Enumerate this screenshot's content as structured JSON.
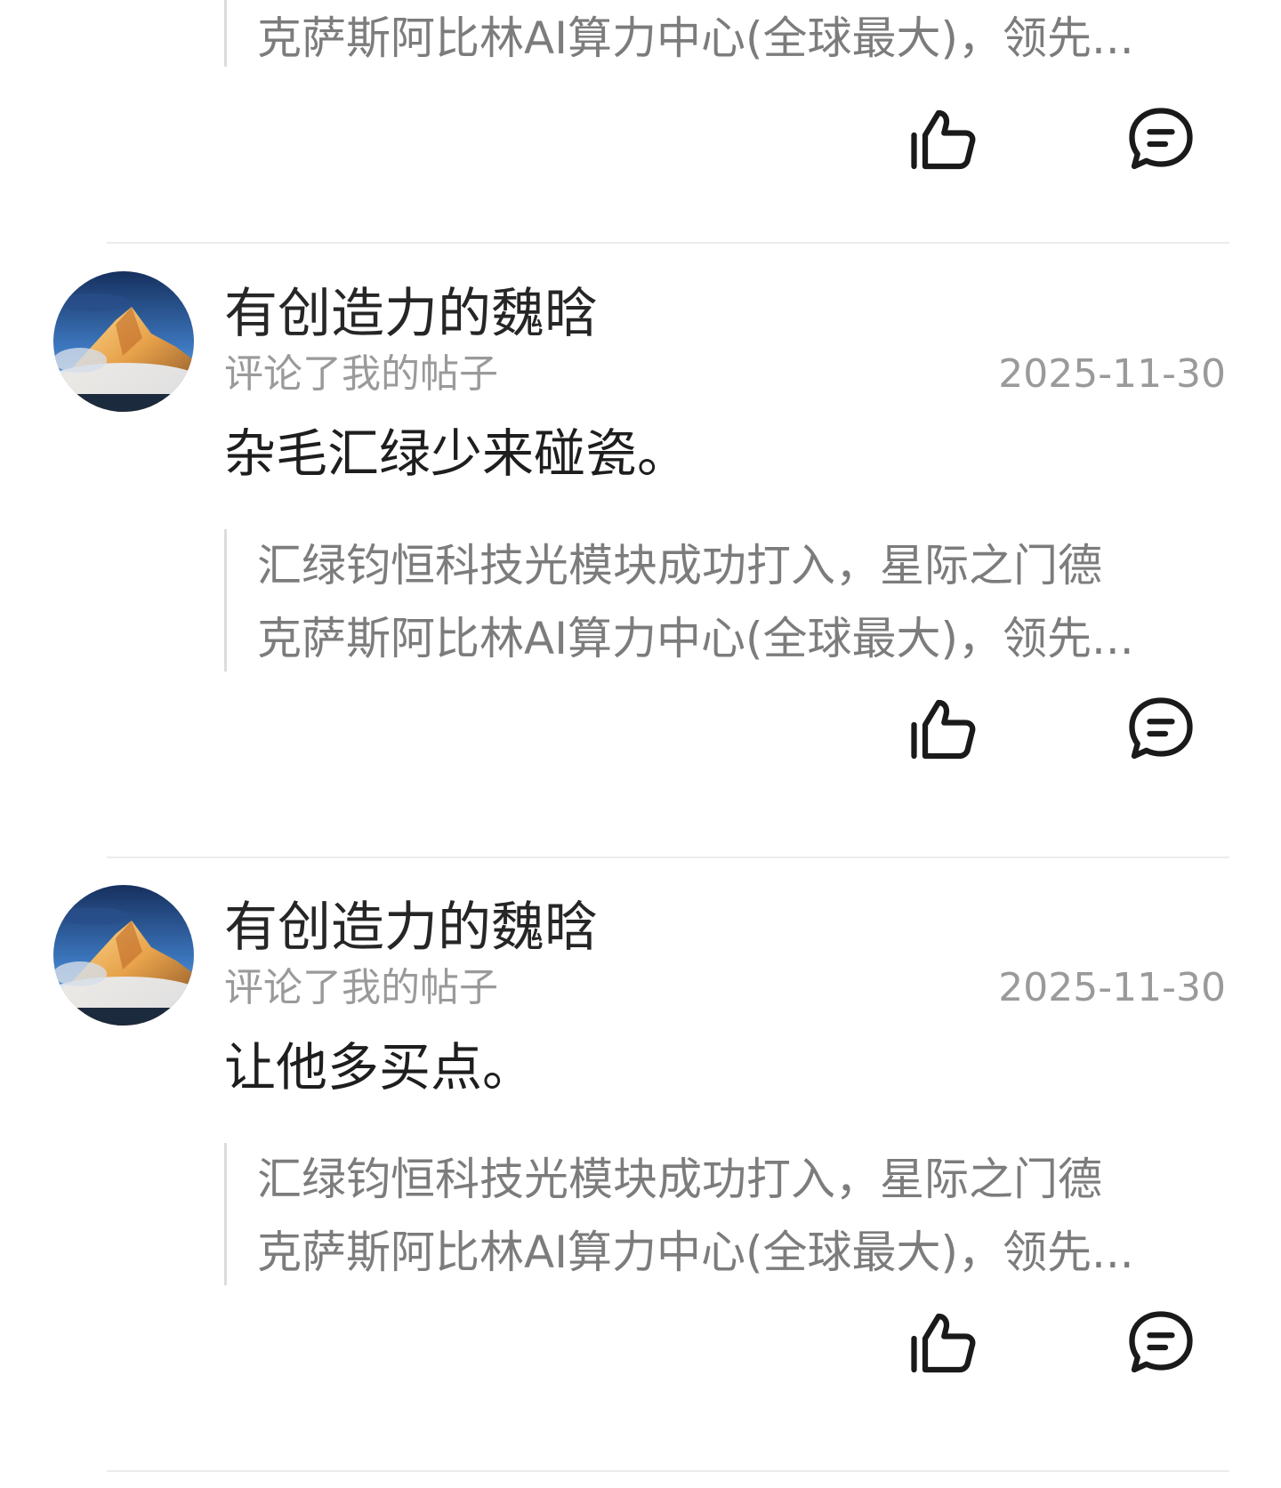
{
  "partial_item": {
    "quote_line_2": "克萨斯阿比林AI算力中心(全球最大)，领先...",
    "actions": {
      "like_icon": "thumbs-up-icon",
      "comment_icon": "comment-icon"
    }
  },
  "notifications": [
    {
      "username": "有创造力的魏晗",
      "action": "评论了我的帖子",
      "date": "2025-11-30",
      "content": "杂毛汇绿少来碰瓷。",
      "quote_lines": [
        "汇绿钧恒科技光模块成功打入，星际之门德",
        "克萨斯阿比林AI算力中心(全球最大)，领先..."
      ]
    },
    {
      "username": "有创造力的魏晗",
      "action": "评论了我的帖子",
      "date": "2025-11-30",
      "content": "让他多买点。",
      "quote_lines": [
        "汇绿钧恒科技光模块成功打入，星际之门德",
        "克萨斯阿比林AI算力中心(全球最大)，领先..."
      ]
    }
  ],
  "colors": {
    "text_primary": "#262626",
    "text_secondary": "#9a9a9a",
    "quote_text": "#7c7c7c",
    "divider": "#ececec"
  }
}
